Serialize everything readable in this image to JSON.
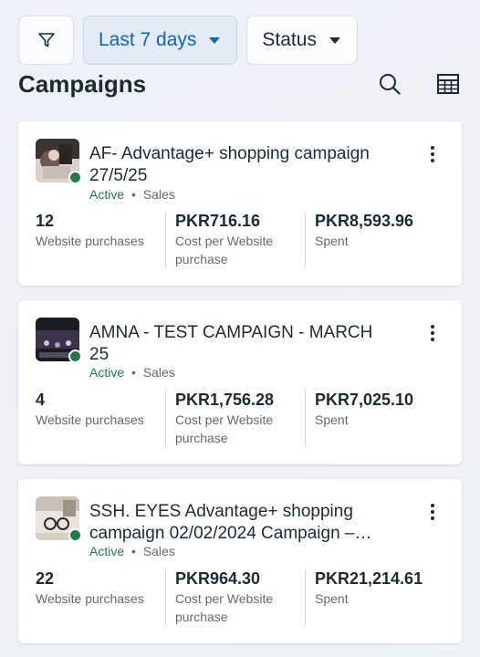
{
  "filters": {
    "date_range": "Last 7 days",
    "status": "Status",
    "filter_icon": "filter-icon"
  },
  "header": {
    "title": "Campaigns",
    "icons": [
      "search-icon",
      "table-icon"
    ]
  },
  "campaigns": [
    {
      "title_line1": "AF- Advantage+ shopping campaign",
      "title_line2": "27/5/25",
      "status": "Active",
      "objective": "Sales",
      "metrics": [
        {
          "value": "12",
          "label": "Website purchases"
        },
        {
          "value": "PKR716.16",
          "label": "Cost per Website purchase"
        },
        {
          "value": "PKR8,593.96",
          "label": "Spent"
        }
      ]
    },
    {
      "title_line1": "AMNA - TEST CAMPAIGN - MARCH",
      "title_line2": "25",
      "status": "Active",
      "objective": "Sales",
      "metrics": [
        {
          "value": "4",
          "label": "Website purchases"
        },
        {
          "value": "PKR1,756.28",
          "label": "Cost per Website purchase"
        },
        {
          "value": "PKR7,025.10",
          "label": "Spent"
        }
      ]
    },
    {
      "title_line1": "SSH. EYES Advantage+ shopping",
      "title_line2": "campaign 02/02/2024 Campaign –…",
      "status": "Active",
      "objective": "Sales",
      "metrics": [
        {
          "value": "22",
          "label": "Website purchases"
        },
        {
          "value": "PKR964.30",
          "label": "Cost per Website purchase"
        },
        {
          "value": "PKR21,214.61",
          "label": "Spent"
        }
      ]
    }
  ],
  "colors": {
    "accent": "#0a66c2",
    "active_status": "#1f7a4c",
    "text": "#1c2b33",
    "muted": "#65676b"
  },
  "separator": "•"
}
